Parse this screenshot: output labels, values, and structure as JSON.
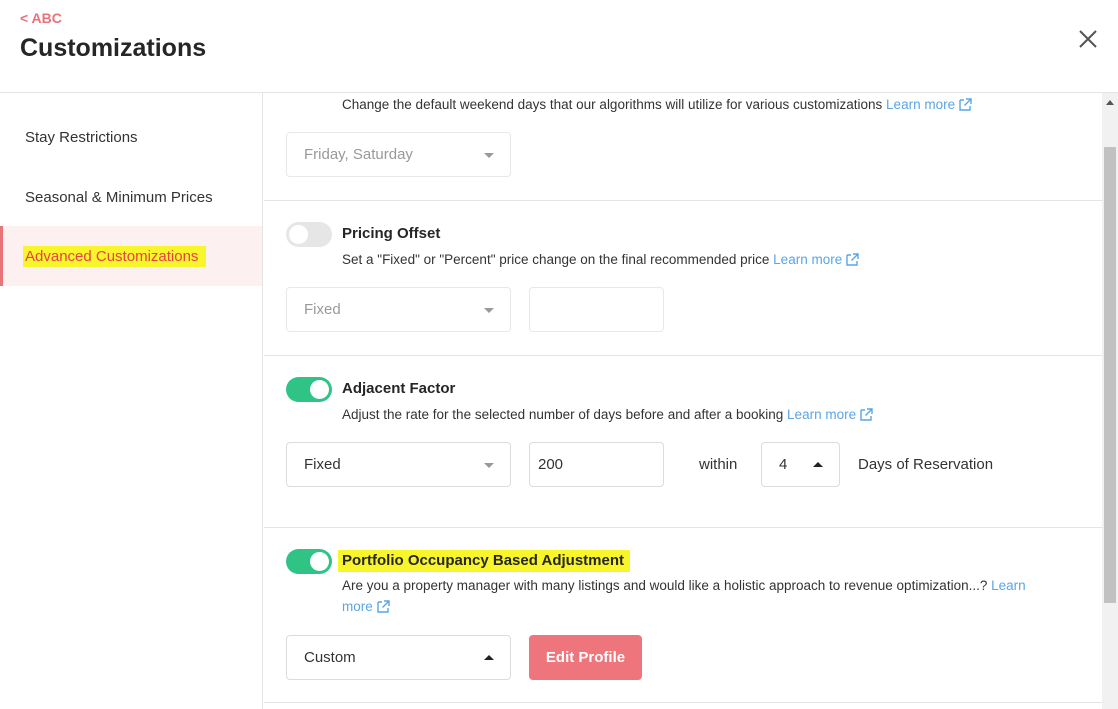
{
  "header": {
    "back_label": "< ABC",
    "title": "Customizations"
  },
  "sidebar": {
    "items": [
      {
        "label": "Stay Restrictions"
      },
      {
        "label": "Seasonal & Minimum Prices"
      },
      {
        "label": "Advanced Customizations"
      }
    ]
  },
  "weekend": {
    "description": "Change the default weekend days that our algorithms will utilize for various customizations",
    "learn_more": "Learn more",
    "select_value": "Friday, Saturday"
  },
  "pricing_offset": {
    "title": "Pricing Offset",
    "enabled": false,
    "description": "Set a \"Fixed\" or \"Percent\" price change on the final recommended price",
    "learn_more": "Learn more",
    "type_value": "Fixed",
    "amount_value": ""
  },
  "adjacent_factor": {
    "title": "Adjacent Factor",
    "enabled": true,
    "description": "Adjust the rate for the selected number of days before and after a booking",
    "learn_more": "Learn more",
    "type_value": "Fixed",
    "amount_value": "200",
    "within_label": "within",
    "days_value": "4",
    "days_suffix": "Days of Reservation"
  },
  "portfolio_occupancy": {
    "title": "Portfolio Occupancy Based Adjustment",
    "enabled": true,
    "description": "Are you a property manager with many listings and would like a holistic approach to revenue optimization...?",
    "learn_more_1": "Learn",
    "learn_more_2": "more",
    "profile_value": "Custom",
    "edit_button": "Edit Profile"
  },
  "colors": {
    "accent": "#e8737b",
    "toggle_on": "#2fc486",
    "link": "#5aa5e6",
    "highlight": "#f8f62a"
  }
}
